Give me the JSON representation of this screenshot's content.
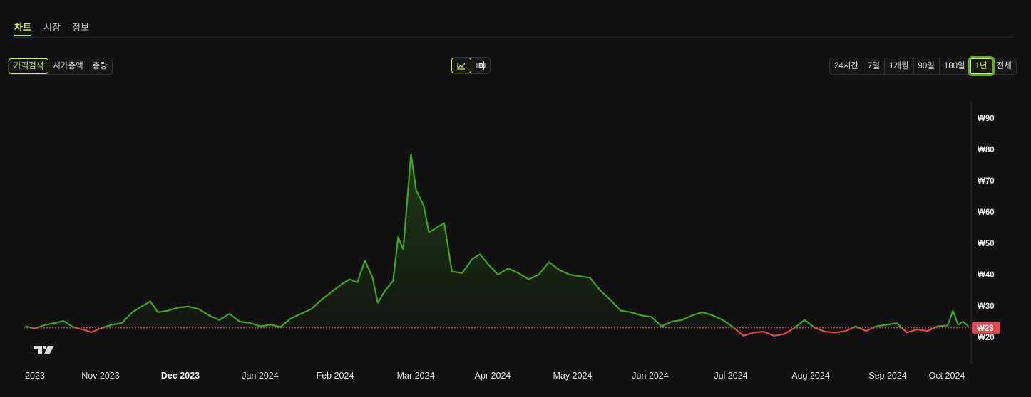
{
  "tabs": [
    "차트",
    "시장",
    "정보"
  ],
  "metric_buttons": [
    "가격검색",
    "시가총액",
    "총량"
  ],
  "chart_type_icons": [
    "line-chart-icon",
    "candlestick-icon"
  ],
  "range_buttons": [
    "24시간",
    "7일",
    "1개월",
    "90일",
    "180일",
    "1년",
    "전체"
  ],
  "selected_range": "1년",
  "selected_metric": "가격검색",
  "colors": {
    "accent": "#c8f25a",
    "up": "#3fa51e",
    "down": "#e5484d",
    "background": "#111111"
  },
  "chart_data": {
    "type": "area",
    "currency": "₩",
    "current_price_label": "₩23",
    "reference_value": 23,
    "ylim": [
      20,
      94
    ],
    "y_ticks": [
      "₩90",
      "₩80",
      "₩70",
      "₩60",
      "₩50",
      "₩40",
      "₩30",
      "₩20"
    ],
    "y_tick_values": [
      90,
      80,
      70,
      60,
      50,
      40,
      30,
      20
    ],
    "x_ticks": [
      "2023",
      "Nov 2023",
      "Dec 2023",
      "Jan 2024",
      "Feb 2024",
      "Mar 2024",
      "Apr 2024",
      "May 2024",
      "Jun 2024",
      "Jul 2024",
      "Aug 2024",
      "Sep 2024",
      "Oct 2024"
    ],
    "x_tick_bold": "Dec 2023",
    "x_start": "2023-10-14",
    "x_end": "2024-10-17",
    "series": [
      {
        "points": [
          [
            "2023-10-14",
            23.5
          ],
          [
            "2023-10-18",
            22.8
          ],
          [
            "2023-10-22",
            24.0
          ],
          [
            "2023-10-26",
            24.6
          ],
          [
            "2023-10-29",
            25.2
          ],
          [
            "2023-11-02",
            23.2
          ],
          [
            "2023-11-06",
            22.4
          ],
          [
            "2023-11-09",
            21.6
          ],
          [
            "2023-11-13",
            23.0
          ],
          [
            "2023-11-17",
            24.0
          ],
          [
            "2023-11-21",
            24.6
          ],
          [
            "2023-11-25",
            28.0
          ],
          [
            "2023-11-29",
            30.0
          ],
          [
            "2023-12-02",
            31.5
          ],
          [
            "2023-12-05",
            28.0
          ],
          [
            "2023-12-09",
            28.5
          ],
          [
            "2023-12-13",
            29.5
          ],
          [
            "2023-12-17",
            29.8
          ],
          [
            "2023-12-21",
            29.0
          ],
          [
            "2023-12-25",
            27.0
          ],
          [
            "2023-12-29",
            25.5
          ],
          [
            "2024-01-02",
            27.5
          ],
          [
            "2024-01-06",
            25.0
          ],
          [
            "2024-01-10",
            24.6
          ],
          [
            "2024-01-14",
            23.5
          ],
          [
            "2024-01-18",
            24.0
          ],
          [
            "2024-01-22",
            23.3
          ],
          [
            "2024-01-26",
            26.0
          ],
          [
            "2024-01-30",
            27.5
          ],
          [
            "2024-02-03",
            29.0
          ],
          [
            "2024-02-07",
            32.0
          ],
          [
            "2024-02-11",
            34.5
          ],
          [
            "2024-02-15",
            37.0
          ],
          [
            "2024-02-18",
            38.5
          ],
          [
            "2024-02-21",
            37.5
          ],
          [
            "2024-02-24",
            44.5
          ],
          [
            "2024-02-27",
            39.0
          ],
          [
            "2024-02-29",
            31.0
          ],
          [
            "2024-03-03",
            35.0
          ],
          [
            "2024-03-06",
            38.0
          ],
          [
            "2024-03-08",
            52.0
          ],
          [
            "2024-03-10",
            48.0
          ],
          [
            "2024-03-13",
            78.5
          ],
          [
            "2024-03-15",
            67.0
          ],
          [
            "2024-03-18",
            62.0
          ],
          [
            "2024-03-20",
            53.5
          ],
          [
            "2024-03-23",
            55.0
          ],
          [
            "2024-03-26",
            56.5
          ],
          [
            "2024-03-29",
            41.0
          ],
          [
            "2024-04-02",
            40.5
          ],
          [
            "2024-04-06",
            45.0
          ],
          [
            "2024-04-09",
            46.5
          ],
          [
            "2024-04-12",
            43.5
          ],
          [
            "2024-04-16",
            40.0
          ],
          [
            "2024-04-20",
            42.0
          ],
          [
            "2024-04-24",
            40.5
          ],
          [
            "2024-04-28",
            38.5
          ],
          [
            "2024-05-02",
            40.0
          ],
          [
            "2024-05-06",
            44.0
          ],
          [
            "2024-05-10",
            41.5
          ],
          [
            "2024-05-14",
            40.0
          ],
          [
            "2024-05-18",
            39.5
          ],
          [
            "2024-05-22",
            39.0
          ],
          [
            "2024-05-26",
            35.0
          ],
          [
            "2024-05-30",
            32.0
          ],
          [
            "2024-06-03",
            28.5
          ],
          [
            "2024-06-07",
            28.0
          ],
          [
            "2024-06-11",
            27.0
          ],
          [
            "2024-06-15",
            26.5
          ],
          [
            "2024-06-19",
            23.5
          ],
          [
            "2024-06-23",
            25.0
          ],
          [
            "2024-06-27",
            25.5
          ],
          [
            "2024-07-01",
            27.0
          ],
          [
            "2024-07-05",
            28.0
          ],
          [
            "2024-07-09",
            27.0
          ],
          [
            "2024-07-13",
            25.5
          ],
          [
            "2024-07-17",
            23.2
          ],
          [
            "2024-07-21",
            20.5
          ],
          [
            "2024-07-25",
            21.5
          ],
          [
            "2024-07-29",
            21.8
          ],
          [
            "2024-08-02",
            20.5
          ],
          [
            "2024-08-06",
            21.0
          ],
          [
            "2024-08-10",
            23.0
          ],
          [
            "2024-08-14",
            25.5
          ],
          [
            "2024-08-18",
            23.0
          ],
          [
            "2024-08-22",
            21.8
          ],
          [
            "2024-08-26",
            21.5
          ],
          [
            "2024-08-30",
            22.0
          ],
          [
            "2024-09-03",
            23.5
          ],
          [
            "2024-09-07",
            22.0
          ],
          [
            "2024-09-11",
            23.5
          ],
          [
            "2024-09-15",
            24.0
          ],
          [
            "2024-09-19",
            24.5
          ],
          [
            "2024-09-23",
            21.5
          ],
          [
            "2024-09-27",
            22.5
          ],
          [
            "2024-10-01",
            22.0
          ],
          [
            "2024-10-05",
            23.5
          ],
          [
            "2024-10-09",
            23.8
          ],
          [
            "2024-10-11",
            28.5
          ],
          [
            "2024-10-13",
            24.0
          ],
          [
            "2024-10-15",
            25.0
          ],
          [
            "2024-10-17",
            23.5
          ]
        ]
      }
    ]
  }
}
